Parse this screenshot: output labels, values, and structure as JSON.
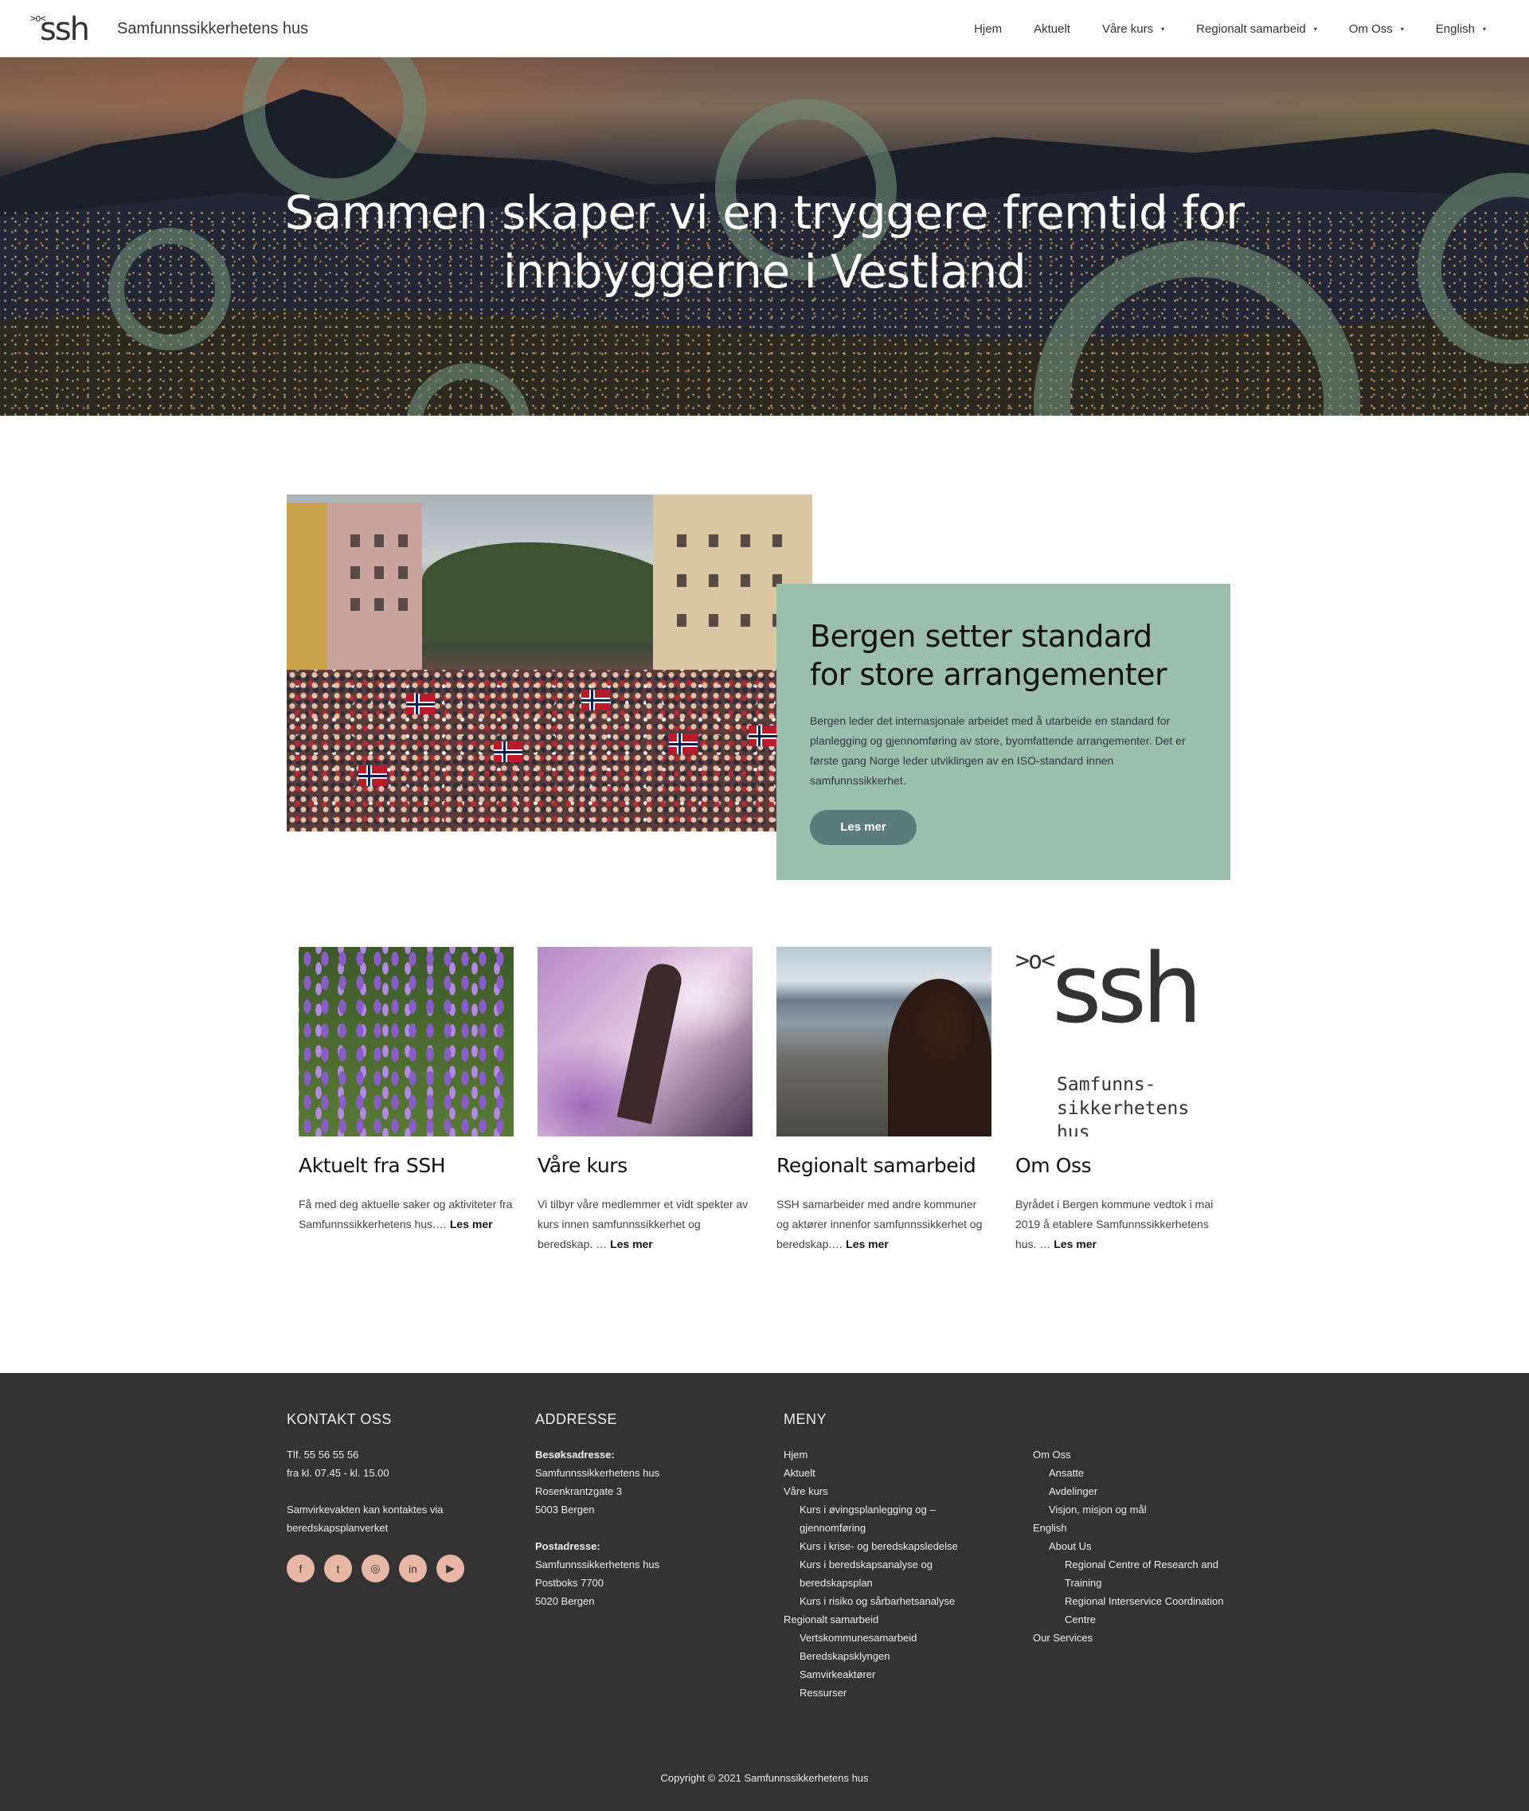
{
  "header": {
    "logo_symbol": ">o<",
    "logo_word": "ssh",
    "site_title": "Samfunnssikkerhetens hus",
    "nav": [
      {
        "label": "Hjem",
        "dropdown": false
      },
      {
        "label": "Aktuelt",
        "dropdown": false
      },
      {
        "label": "Våre kurs",
        "dropdown": true
      },
      {
        "label": "Regionalt samarbeid",
        "dropdown": true
      },
      {
        "label": "Om Oss",
        "dropdown": true
      },
      {
        "label": "English",
        "dropdown": true
      }
    ],
    "caret": "▾"
  },
  "hero": {
    "title_line1": "Sammen skaper vi en tryggere fremtid for",
    "title_line2": "innbyggerne i Vestland"
  },
  "feature": {
    "title": "Bergen setter standard for store arrangementer",
    "text": "Bergen leder det internasjonale arbeidet med å utarbeide en standard for planlegging og gjennomføring av store, byomfattende arrangementer. Det er første gang Norge leder utviklingen av en ISO-standard innen samfunnssikkerhet.",
    "button": "Les mer"
  },
  "cards": [
    {
      "title": "Aktuelt fra SSH",
      "text": "Få med deg aktuelle saker og aktiviteter fra Samfunnssikkerhetens hus.…",
      "more": "Les mer"
    },
    {
      "title": "Våre kurs",
      "text": "Vi tilbyr våre medlemmer et vidt spekter av kurs innen samfunnssikkerhet og beredskap. …",
      "more": "Les mer"
    },
    {
      "title": "Regionalt samarbeid",
      "text": "SSH samarbeider med andre kommuner og aktører innenfor samfunnssikkerhet og beredskap.…",
      "more": "Les mer"
    },
    {
      "title": "Om Oss",
      "text": "Byrådet i Bergen kommune vedtok i mai 2019 å etablere Samfunnssikkerhetens hus. …",
      "more": "Les mer"
    }
  ],
  "om_oss_logo": {
    "symbol": ">o<",
    "word": "ssh",
    "text": "Samfunns-\nsikkerhetens\nhus"
  },
  "footer": {
    "kontakt": {
      "heading": "KONTAKT OSS",
      "phone": "Tlf. 55 56 55 56",
      "hours": "fra kl. 07.45 - kl. 15.00",
      "samvirke1": "Samvirkevakten kan kontaktes via",
      "samvirke2": "beredskapsplanverket"
    },
    "socials": [
      {
        "icon": "facebook-icon",
        "glyph": "f"
      },
      {
        "icon": "twitter-icon",
        "glyph": "t"
      },
      {
        "icon": "instagram-icon",
        "glyph": "◎"
      },
      {
        "icon": "linkedin-icon",
        "glyph": "in"
      },
      {
        "icon": "youtube-icon",
        "glyph": "▶"
      }
    ],
    "adresse": {
      "heading": "ADDRESSE",
      "besok_label": "Besøksadresse:",
      "besok1": "Samfunnssikkerhetens hus",
      "besok2": "Rosenkrantzgate 3",
      "besok3": "5003 Bergen",
      "post_label": "Postadresse:",
      "post1": "Samfunnssikkerhetens hus",
      "post2": "Postboks 7700",
      "post3": "5020 Bergen"
    },
    "meny": {
      "heading": "MENY",
      "col1": [
        {
          "label": "Hjem",
          "level": 0
        },
        {
          "label": "Aktuelt",
          "level": 0
        },
        {
          "label": "Våre kurs",
          "level": 0
        },
        {
          "label": "Kurs i øvingsplanlegging og –",
          "level": 1
        },
        {
          "label": "gjennomføring",
          "level": 1
        },
        {
          "label": "Kurs i krise- og beredskapsledelse",
          "level": 1
        },
        {
          "label": "Kurs i beredskapsanalyse og",
          "level": 1
        },
        {
          "label": "beredskapsplan",
          "level": 1
        },
        {
          "label": "Kurs i risiko og sårbarhetsanalyse",
          "level": 1
        },
        {
          "label": "Regionalt samarbeid",
          "level": 0
        },
        {
          "label": "Vertskommunesamarbeid",
          "level": 1
        },
        {
          "label": "Beredskapsklyngen",
          "level": 1
        },
        {
          "label": "Samvirkeaktører",
          "level": 1
        },
        {
          "label": "Ressurser",
          "level": 1
        }
      ],
      "col2": [
        {
          "label": "Om Oss",
          "level": 0
        },
        {
          "label": "Ansatte",
          "level": 1
        },
        {
          "label": "Avdelinger",
          "level": 1
        },
        {
          "label": "Visjon, misjon og mål",
          "level": 1
        },
        {
          "label": "English",
          "level": 0
        },
        {
          "label": "About Us",
          "level": 1
        },
        {
          "label": "Regional Centre of Research and",
          "level": 2
        },
        {
          "label": "Training",
          "level": 2
        },
        {
          "label": "Regional Interservice Coordination",
          "level": 2
        },
        {
          "label": "Centre",
          "level": 2
        },
        {
          "label": "Our Services",
          "level": 0
        }
      ]
    },
    "copyright": "Copyright © 2021 Samfunnssikkerhetens hus"
  },
  "colors": {
    "feature_card": "#9bbfac",
    "button": "#5b7b7d",
    "footer": "#333333",
    "social": "#e8b7a6",
    "hero_rings": "#6e8c78"
  }
}
